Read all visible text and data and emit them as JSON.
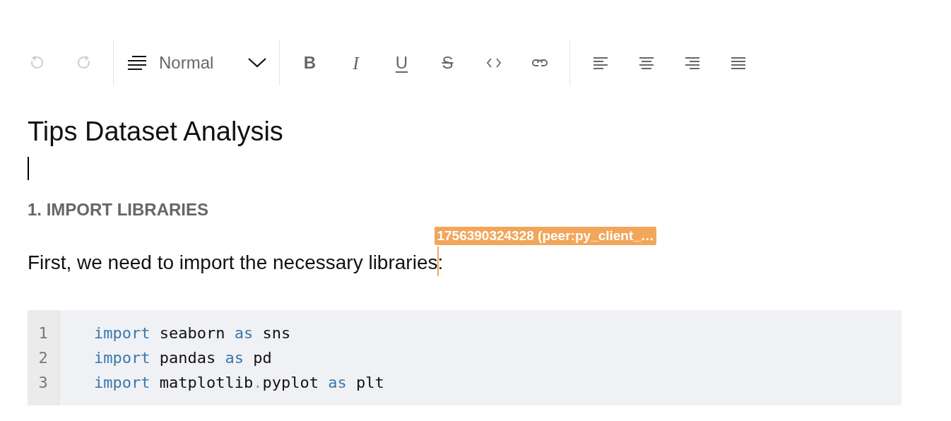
{
  "toolbar": {
    "buttons": [
      {
        "kind": "undo",
        "disabled": true
      },
      {
        "kind": "redo",
        "disabled": true
      },
      {
        "kind": "divider"
      },
      {
        "kind": "block_type",
        "label": "Normal"
      },
      {
        "kind": "divider"
      },
      {
        "kind": "bold",
        "label": "B",
        "disabled": false
      },
      {
        "kind": "italic",
        "label": "I",
        "disabled": false
      },
      {
        "kind": "underline",
        "label": "U",
        "disabled": false
      },
      {
        "kind": "strikethrough",
        "label": "S",
        "disabled": false
      },
      {
        "kind": "code",
        "disabled": false
      },
      {
        "kind": "link",
        "disabled": false
      },
      {
        "kind": "divider"
      },
      {
        "kind": "align_left",
        "disabled": false
      },
      {
        "kind": "align_center",
        "disabled": false
      },
      {
        "kind": "align_right",
        "disabled": false
      },
      {
        "kind": "justify",
        "disabled": false
      }
    ]
  },
  "document": {
    "title": "Tips Dataset Analysis",
    "blocks": [
      {
        "kind": "caret_line"
      },
      {
        "kind": "heading",
        "text": "1. IMPORT LIBRARIES"
      },
      {
        "kind": "paragraph",
        "text_before_cursor": "First, we need to import the necessary libraries",
        "text_after_cursor": ":",
        "remote_cursor": {
          "label": "1756390324328 (peer:py_client_…",
          "color": "#f2a65a"
        }
      },
      {
        "kind": "code",
        "lines": [
          {
            "number": "1",
            "tokens": [
              {
                "kind": "keyword",
                "text": "import"
              },
              {
                "kind": "identifier",
                "text": " seaborn "
              },
              {
                "kind": "keyword",
                "text": "as"
              },
              {
                "kind": "identifier",
                "text": " sns"
              }
            ]
          },
          {
            "number": "2",
            "tokens": [
              {
                "kind": "keyword",
                "text": "import"
              },
              {
                "kind": "identifier",
                "text": " pandas "
              },
              {
                "kind": "keyword",
                "text": "as"
              },
              {
                "kind": "identifier",
                "text": " pd"
              }
            ]
          },
          {
            "number": "3",
            "tokens": [
              {
                "kind": "keyword",
                "text": "import"
              },
              {
                "kind": "identifier",
                "text": " matplotlib"
              },
              {
                "kind": "punct",
                "text": "."
              },
              {
                "kind": "identifier",
                "text": "pyplot "
              },
              {
                "kind": "keyword",
                "text": "as"
              },
              {
                "kind": "identifier",
                "text": " plt"
              }
            ]
          }
        ]
      }
    ]
  }
}
